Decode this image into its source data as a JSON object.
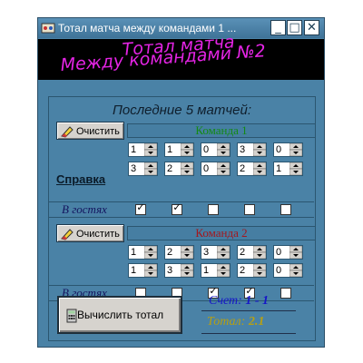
{
  "window": {
    "title": "Тотал матча между командами 1 ...",
    "minimize_glyph": "_",
    "maximize_glyph": "□",
    "close_glyph": "✕"
  },
  "banner": {
    "line1": "Тотал матча",
    "line2": "Между командами №2"
  },
  "panel": {
    "subtitle": "Последние 5 матчей:"
  },
  "team1": {
    "clear_label": "Очистить",
    "name": "Команда 1",
    "name_color": "#138a13",
    "help_label": "Справка",
    "scores_row1": [
      "1",
      "1",
      "0",
      "3",
      "0"
    ],
    "scores_row2": [
      "3",
      "2",
      "0",
      "2",
      "1"
    ],
    "away_label": "В гостях",
    "away_checked": [
      true,
      true,
      false,
      false,
      false
    ]
  },
  "team2": {
    "clear_label": "Очистить",
    "name": "Команда 2",
    "name_color": "#a3181e",
    "scores_row1": [
      "1",
      "2",
      "3",
      "2",
      "0"
    ],
    "scores_row2": [
      "1",
      "3",
      "1",
      "2",
      "0"
    ],
    "away_label": "В гостях",
    "away_checked": [
      false,
      false,
      true,
      true,
      false
    ]
  },
  "footer": {
    "calc_label": "Вычислить тотал",
    "score_label": "Счет:",
    "score_value": "1 - 1",
    "total_label": "Тотал:",
    "total_value": "2.1"
  },
  "colors": {
    "window_bg": "#4a82a6",
    "banner_text": "#e424e4",
    "score_text": "#1515c8",
    "total_text": "#b8a012"
  },
  "icons": {
    "app": "app-icon",
    "clear": "eraser-icon",
    "calc": "calculator-icon"
  }
}
